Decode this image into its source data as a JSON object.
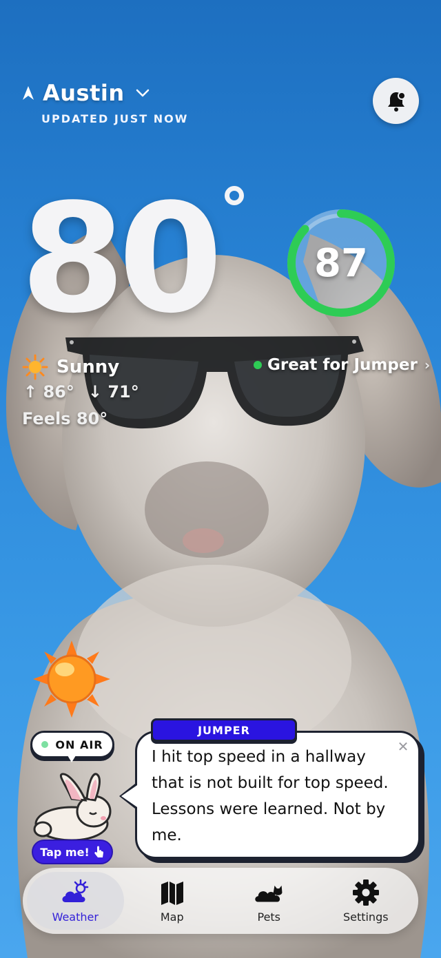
{
  "header": {
    "city": "Austin",
    "updated": "UPDATED JUST NOW"
  },
  "weather": {
    "temperature": "80",
    "score": "87",
    "score_fraction": 0.87,
    "condition": "Sunny",
    "high": "86°",
    "low": "71°",
    "feels_like": "Feels 80°",
    "pet_status": "Great for Jumper"
  },
  "on_air": {
    "label": "ON AIR"
  },
  "tap_me": {
    "label": "Tap me!"
  },
  "message": {
    "speaker": "JUMPER",
    "text": "I hit top speed in a hallway that is not built for top speed. Lessons were learned. Not by me."
  },
  "tabs": [
    {
      "label": "Weather",
      "icon": "cloud-sun-icon",
      "active": true
    },
    {
      "label": "Map",
      "icon": "map-icon",
      "active": false
    },
    {
      "label": "Pets",
      "icon": "cloud-cat-icon",
      "active": false
    },
    {
      "label": "Settings",
      "icon": "gear-icon",
      "active": false
    }
  ],
  "colors": {
    "accent": "#3320d8",
    "score_ring": "#2ecc55",
    "sky": "#2a86d8"
  }
}
